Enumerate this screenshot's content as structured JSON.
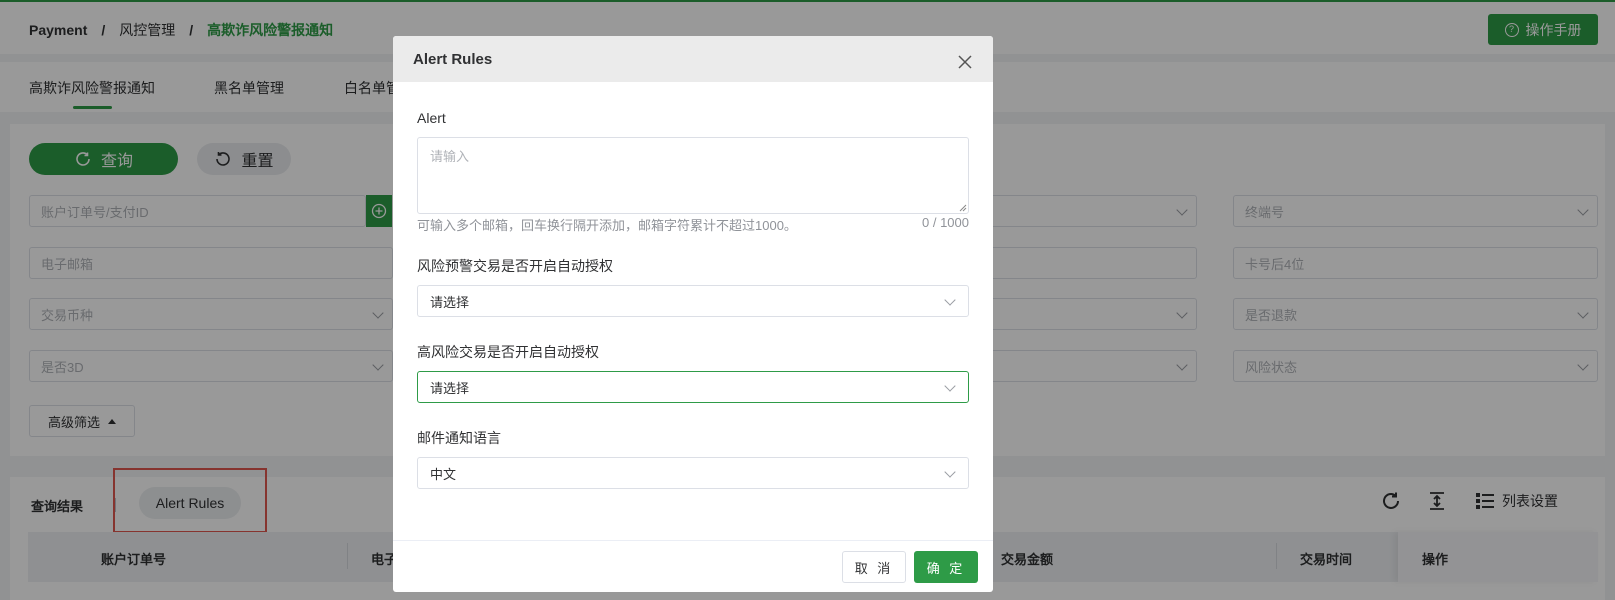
{
  "colors": {
    "primary": "#2e9b47",
    "highlight_box": "#e0584f"
  },
  "header": {
    "breadcrumb": [
      "Payment",
      "风控管理",
      "高欺诈风险警报通知"
    ],
    "breadcrumb_sep": "/",
    "manual_label": "操作手册"
  },
  "tabs": [
    "高欺诈风险警报通知",
    "黑名单管理",
    "白名单管"
  ],
  "filter": {
    "query_label": "查询",
    "reset_label": "重置",
    "left_fields": [
      "账户订单号/支付ID",
      "电子邮箱",
      "交易币种",
      "是否3D"
    ],
    "right_fields": [
      "终端号",
      "卡号后4位",
      "是否退款",
      "风险状态"
    ],
    "advanced_label": "高级筛选"
  },
  "results": {
    "title": "查询结果",
    "alert_rules_label": "Alert Rules",
    "list_settings_label": "列表设置",
    "columns": [
      "账户订单号",
      "电子",
      "交易金额",
      "交易时间",
      "操作"
    ]
  },
  "modal": {
    "title": "Alert Rules",
    "alert_label": "Alert",
    "alert_placeholder": "请输入",
    "alert_hint": "可输入多个邮箱，回车换行隔开添加，邮箱字符累计不超过1000。",
    "alert_count": "0 / 1000",
    "risk_auto_label": "风险预警交易是否开启自动授权",
    "risk_auto_value": "请选择",
    "high_risk_auto_label": "高风险交易是否开启自动授权",
    "high_risk_auto_value": "请选择",
    "lang_label": "邮件通知语言",
    "lang_value": "中文",
    "cancel_label": "取 消",
    "ok_label": "确 定"
  }
}
